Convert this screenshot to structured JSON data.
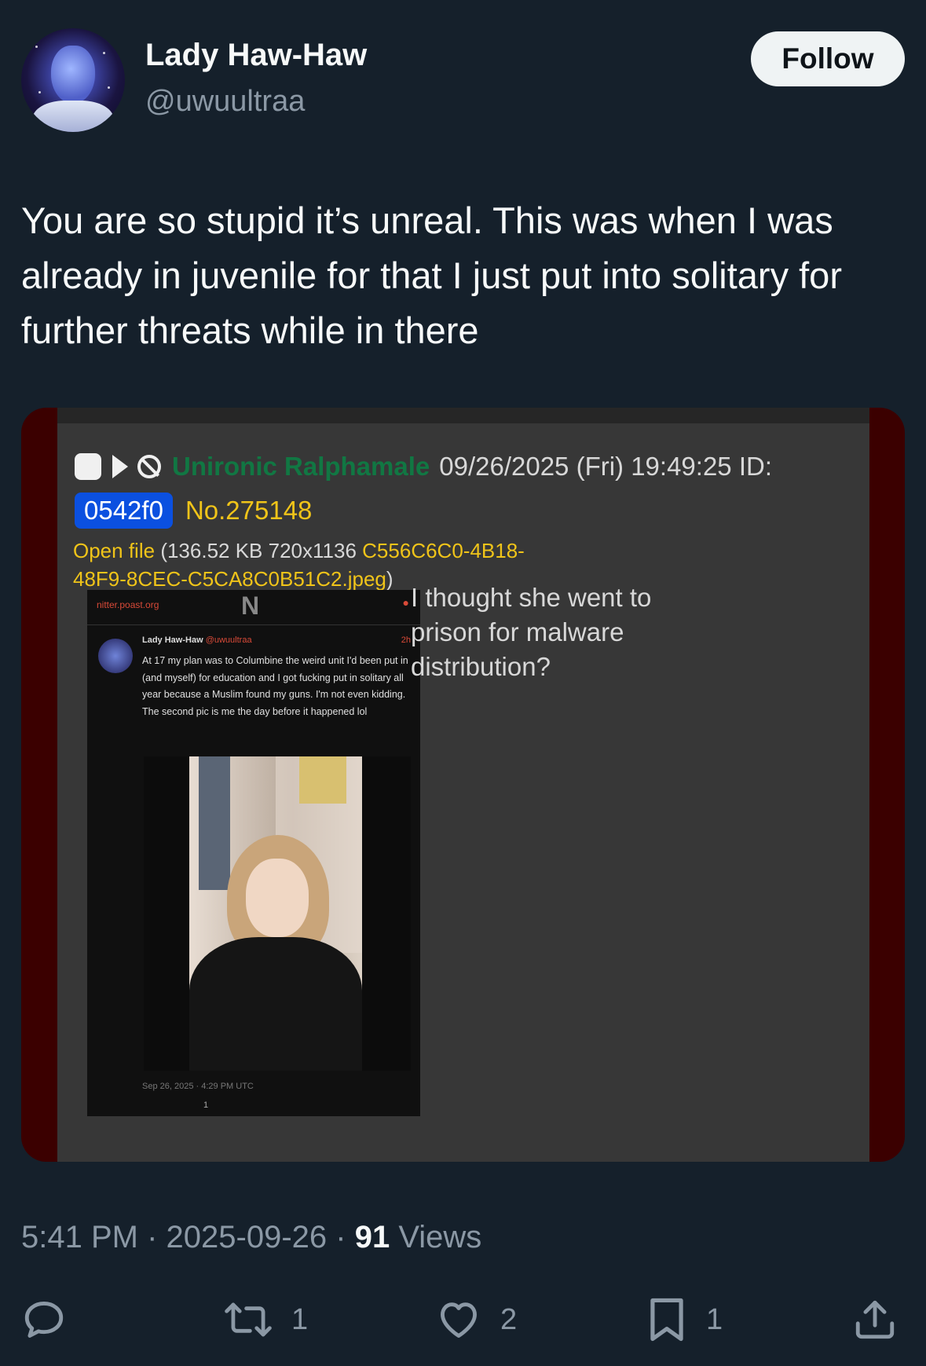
{
  "user": {
    "display_name": "Lady Haw-Haw",
    "handle": "@uwuultraa",
    "follow_label": "Follow"
  },
  "tweet": {
    "text": "You are so stupid it’s unreal. This was when I was already in juvenile for that I just put into solitary for further threats while in there",
    "time": "5:41 PM",
    "date": "2025-09-26",
    "views_count": "91",
    "views_label": "Views"
  },
  "embedded_post": {
    "poster_name": "Unironic Ralphamale",
    "datetime": "09/26/2025 (Fri) 19:49:25 ID:",
    "id": "0542f0",
    "post_number": "No.275148",
    "open_file_label": "Open file",
    "file_meta": "(136.52 KB 720x1136",
    "file_name_line1": "C556C6C0-4B18-",
    "file_name_line2": "48F9-8CEC-C5CA8C0B51C2.jpeg",
    "file_close": ")",
    "comment": "I thought she went to prison for malware distribution?",
    "screenshot": {
      "site": "nitter.poast.org",
      "logo": "N",
      "name": "Lady Haw-Haw",
      "handle": "@uwuultraa",
      "age": "2h",
      "text": "At 17 my plan was to Columbine the weird unit I'd been put in (and myself) for education and I got fucking put in solitary all year because a Muslim found my guns. I'm not even kidding. The second pic is me the day before it happened lol",
      "date": "Sep 26, 2025 · 4:29 PM UTC",
      "count": "1"
    }
  },
  "actions": {
    "reply_count": "",
    "retweet_count": "1",
    "like_count": "2",
    "bookmark_count": "1"
  },
  "colors": {
    "background": "#15202b",
    "poster_name": "#117743",
    "id_badge": "#0b50e0",
    "post_number": "#f0c419"
  }
}
